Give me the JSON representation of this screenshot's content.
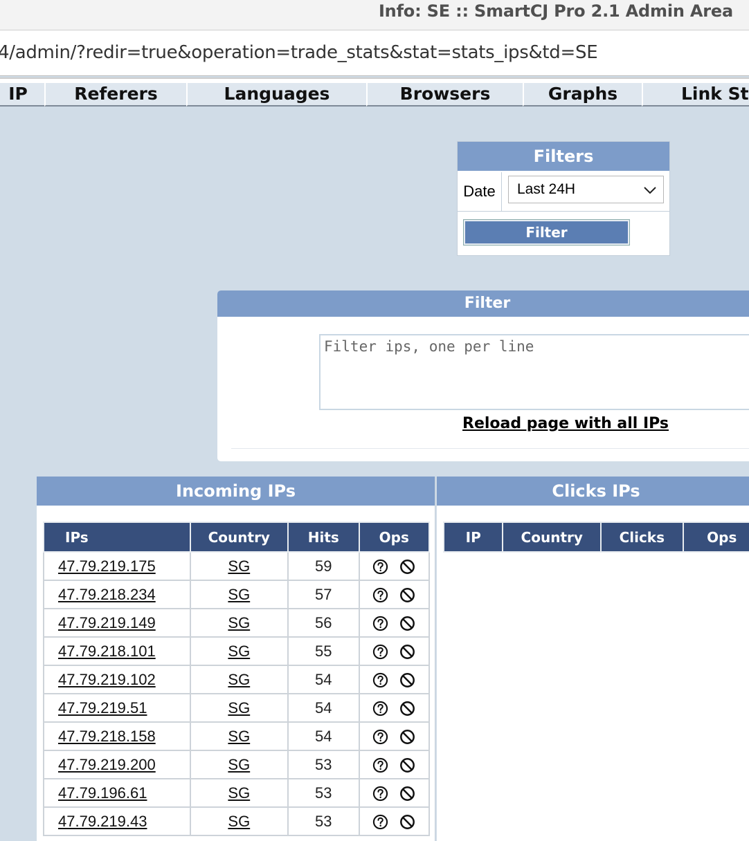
{
  "window": {
    "title": "Info: SE :: SmartCJ Pro 2.1 Admin Area"
  },
  "url": "4/admin/?redir=true&operation=trade_stats&stat=stats_ips&td=SE",
  "tabs": [
    "IP",
    "Referers",
    "Languages",
    "Browsers",
    "Graphs",
    "Link Sta"
  ],
  "filters": {
    "title": "Filters",
    "date_label": "Date",
    "date_value": "Last 24H",
    "button": "Filter"
  },
  "ip_filter": {
    "title": "Filter",
    "placeholder": "Filter ips, one per line",
    "reload_link": "Reload page with all IPs"
  },
  "incoming": {
    "title": "Incoming IPs",
    "headers": [
      "IPs",
      "Country",
      "Hits",
      "Ops"
    ],
    "rows": [
      {
        "ip": "47.79.219.175 ",
        "country": "SG",
        "hits": "59"
      },
      {
        "ip": "47.79.218.234 ",
        "country": "SG",
        "hits": "57"
      },
      {
        "ip": "47.79.219.149 ",
        "country": "SG",
        "hits": "56"
      },
      {
        "ip": "47.79.218.101 ",
        "country": "SG",
        "hits": "55"
      },
      {
        "ip": "47.79.219.102 ",
        "country": "SG",
        "hits": "54"
      },
      {
        "ip": "47.79.219.51 ",
        "country": "SG",
        "hits": "54"
      },
      {
        "ip": "47.79.218.158 ",
        "country": "SG",
        "hits": "54"
      },
      {
        "ip": "47.79.219.200 ",
        "country": "SG",
        "hits": "53"
      },
      {
        "ip": "47.79.196.61 ",
        "country": "SG",
        "hits": "53"
      },
      {
        "ip": "47.79.219.43 ",
        "country": "SG",
        "hits": "53"
      }
    ],
    "op_icons": [
      "question-circle-icon",
      "ban-icon"
    ]
  },
  "clicks": {
    "title": "Clicks IPs",
    "headers": [
      "IP",
      "Country",
      "Clicks",
      "Ops"
    ]
  }
}
